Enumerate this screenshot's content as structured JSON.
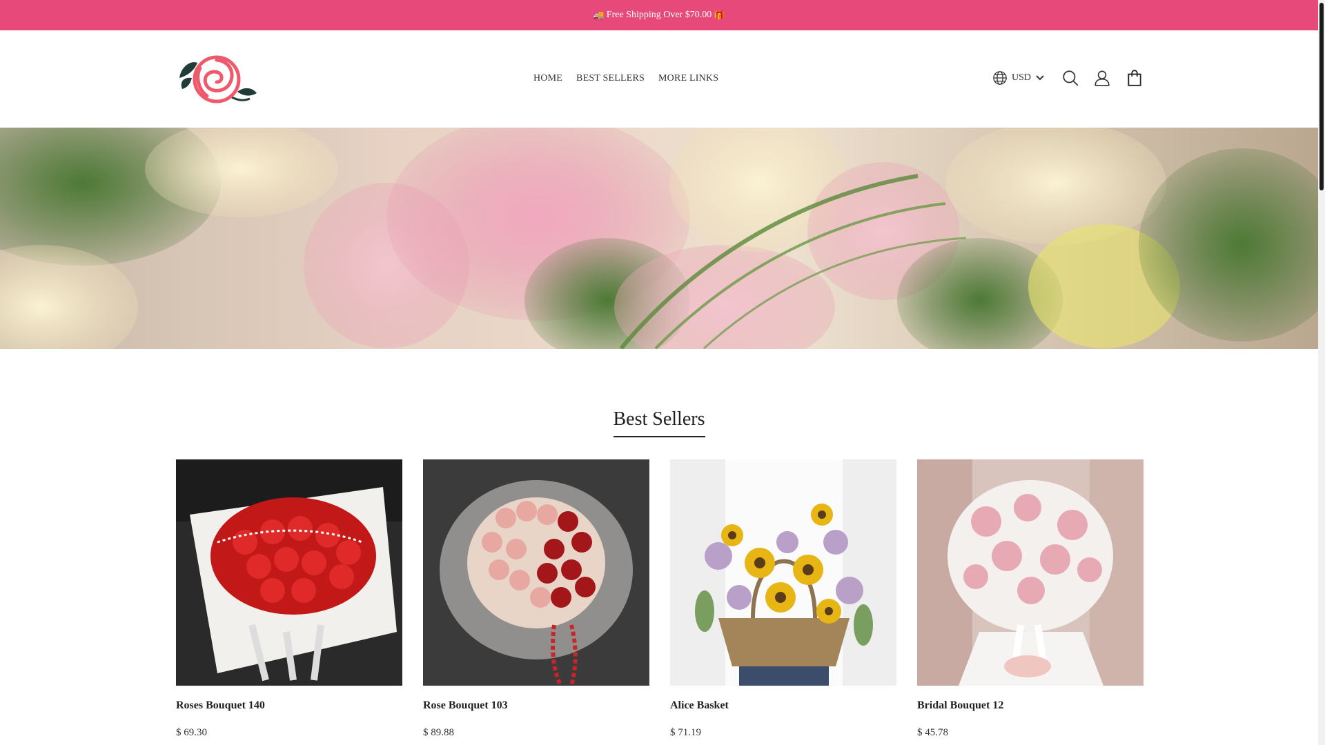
{
  "announcement": {
    "text": "Free Shipping Over $70.00",
    "left_emoji": "🚚",
    "right_emoji": "🎁"
  },
  "header": {
    "logo_alt": "rose-logo",
    "nav": [
      {
        "label": "HOME"
      },
      {
        "label": "BEST SELLERS"
      },
      {
        "label": "MORE LINKS"
      }
    ],
    "currency": "USD",
    "icons": [
      "globe-icon",
      "chevron-down-icon",
      "search-icon",
      "account-icon",
      "cart-icon"
    ]
  },
  "hero": {
    "alt": "flower-arrangement-banner"
  },
  "best_sellers": {
    "title": "Best Sellers",
    "products": [
      {
        "name": "Roses Bouquet 140",
        "price": "$ 69.30"
      },
      {
        "name": "Rose Bouquet 103",
        "price": "$ 89.88"
      },
      {
        "name": "Alice Basket",
        "price": "$ 71.19"
      },
      {
        "name": "Bridal Bouquet 12",
        "price": "$ 45.78"
      }
    ]
  },
  "colors": {
    "accent": "#e8497b",
    "logo_rose": "#ee5a6b",
    "logo_leaf": "#1f3b3a"
  }
}
